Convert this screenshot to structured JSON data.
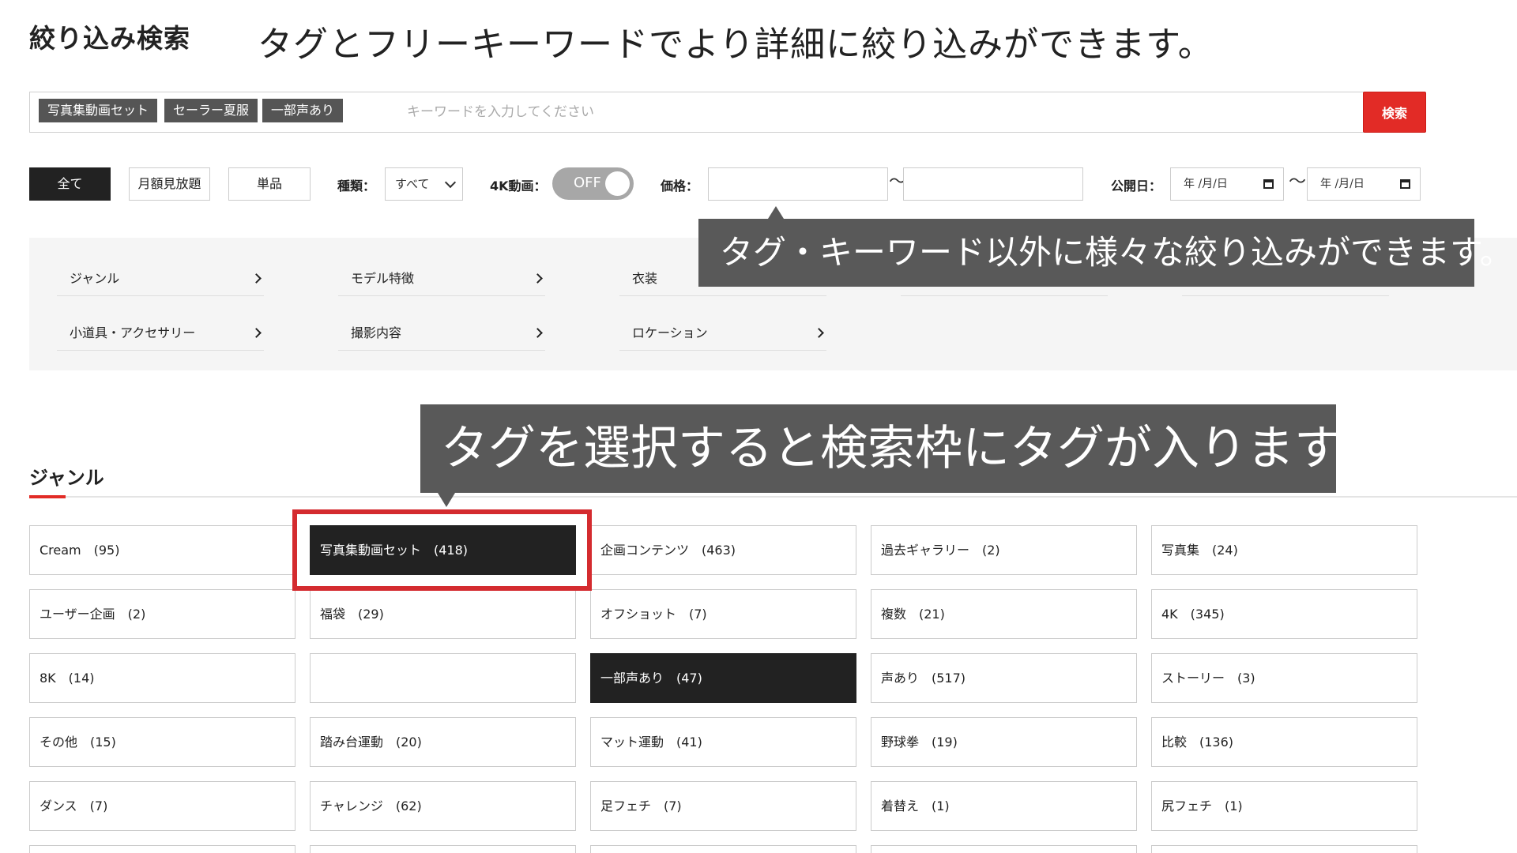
{
  "header": {
    "title": "絞り込み検索",
    "caption": "タグとフリーキーワードでより詳細に絞り込みができます。"
  },
  "search": {
    "selected_tags": [
      "写真集動画セット",
      "セーラー夏服",
      "一部声あり"
    ],
    "placeholder": "キーワードを入力してください",
    "value": "",
    "button_label": "検索"
  },
  "filters": {
    "purchase_types": [
      {
        "label": "全て",
        "active": true
      },
      {
        "label": "月額見放題",
        "active": false
      },
      {
        "label": "単品",
        "active": false
      }
    ],
    "kind_label": "種類：",
    "kind_value": "すべて",
    "video4k_label": "4K動画：",
    "video4k_toggle": "OFF",
    "price_label": "価格：",
    "price_min": "",
    "price_max": "",
    "price_separator": "〜",
    "release_label": "公開日：",
    "date_from": "年 /月/日",
    "date_to": "年 /月/日",
    "date_separator": "〜"
  },
  "categories": [
    {
      "label": "ジャンル"
    },
    {
      "label": "モデル特徴"
    },
    {
      "label": "衣装"
    },
    {
      "label": "小道具・アクセサリー"
    },
    {
      "label": "撮影内容"
    },
    {
      "label": "ロケーション"
    }
  ],
  "annotations": {
    "filters_note": "タグ・キーワード以外に様々な絞り込みができます。",
    "tag_note": "タグを選択すると検索枠にタグが入ります"
  },
  "section": {
    "title": "ジャンル"
  },
  "tags": [
    {
      "label": "Cream　(95)",
      "selected": false
    },
    {
      "label": "写真集動画セット　(418)",
      "selected": true
    },
    {
      "label": "企画コンテンツ　(463)",
      "selected": false
    },
    {
      "label": "過去ギャラリー　(2)",
      "selected": false
    },
    {
      "label": "写真集　(24)",
      "selected": false
    },
    {
      "label": "ユーザー企画　(2)",
      "selected": false
    },
    {
      "label": "福袋　(29)",
      "selected": false
    },
    {
      "label": "オフショット　(7)",
      "selected": false
    },
    {
      "label": "複数　(21)",
      "selected": false
    },
    {
      "label": "4K　(345)",
      "selected": false
    },
    {
      "label": "8K　(14)",
      "selected": false
    },
    {
      "label": "",
      "selected": false
    },
    {
      "label": "一部声あり　(47)",
      "selected": true
    },
    {
      "label": "声あり　(517)",
      "selected": false
    },
    {
      "label": "ストーリー　(3)",
      "selected": false
    },
    {
      "label": "その他　(15)",
      "selected": false
    },
    {
      "label": "踏み台運動　(20)",
      "selected": false
    },
    {
      "label": "マット運動　(41)",
      "selected": false
    },
    {
      "label": "野球拳　(19)",
      "selected": false
    },
    {
      "label": "比較　(136)",
      "selected": false
    },
    {
      "label": "ダンス　(7)",
      "selected": false
    },
    {
      "label": "チャレンジ　(62)",
      "selected": false
    },
    {
      "label": "足フェチ　(7)",
      "selected": false
    },
    {
      "label": "着替え　(1)",
      "selected": false
    },
    {
      "label": "尻フェチ　(1)",
      "selected": false
    }
  ],
  "colors": {
    "accent": "#e22b26",
    "selected": "#222222",
    "callout": "#595959",
    "highlight": "#d42b2f"
  }
}
